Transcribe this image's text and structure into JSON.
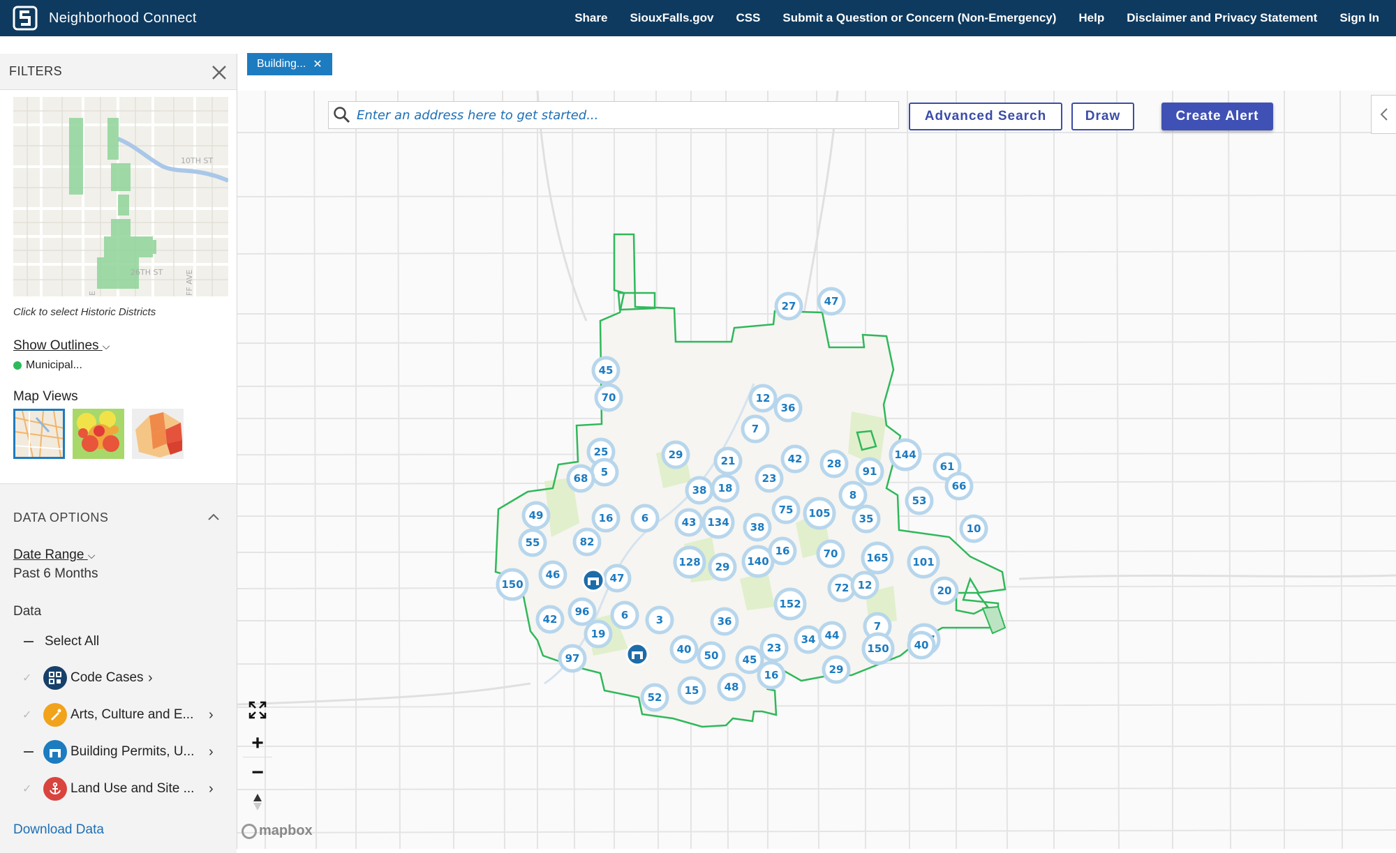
{
  "app": {
    "title": "Neighborhood Connect",
    "brand_color": "#0e3a5f",
    "accent_color": "#1d7bc0"
  },
  "topnav": [
    "Share",
    "SiouxFalls.gov",
    "CSS",
    "Submit a Question or Concern (Non-Emergency)",
    "Help",
    "Disclaimer and Privacy Statement",
    "Sign In"
  ],
  "active_filter_chip": "Building...",
  "filters_panel": {
    "header": "FILTERS",
    "historic_map": {
      "street_labels": [
        "10TH ST",
        "26TH ST",
        "E",
        "FF AVE"
      ],
      "caption": "Click to select Historic Districts"
    },
    "show_outlines_label": "Show Outlines",
    "outline_item": "Municipal...",
    "map_views_label": "Map Views",
    "map_views": [
      "street-map-view",
      "heat-map-view",
      "choropleth-map-view"
    ]
  },
  "data_options": {
    "title": "DATA OPTIONS",
    "date_range_label": "Date Range",
    "date_range_value": "Past 6 Months",
    "data_label": "Data",
    "select_all": "Select All",
    "categories": [
      {
        "label": "Code Cases",
        "icon": "code-cases-icon",
        "color": "#16406a",
        "state": "unchecked"
      },
      {
        "label": "Arts, Culture and E...",
        "icon": "paintbrush-icon",
        "color": "#f1a31b",
        "state": "unchecked"
      },
      {
        "label": "Building Permits, U...",
        "icon": "building-permit-icon",
        "color": "#1d7bc0",
        "state": "partial"
      },
      {
        "label": "Land Use and Site ...",
        "icon": "anchor-icon",
        "color": "#d9443f",
        "state": "unchecked"
      }
    ],
    "download_label": "Download Data"
  },
  "map": {
    "search_placeholder": "Enter an address here to get started...",
    "advanced_search_label": "Advanced Search",
    "draw_label": "Draw",
    "create_alert_label": "Create Alert",
    "attribution": "mapbox",
    "clusters": [
      "27",
      "47",
      "45",
      "70",
      "12",
      "36",
      "7",
      "25",
      "29",
      "21",
      "42",
      "28",
      "91",
      "144",
      "61",
      "66",
      "5",
      "68",
      "23",
      "38",
      "18",
      "8",
      "53",
      "49",
      "16",
      "6",
      "43",
      "134",
      "38",
      "75",
      "105",
      "35",
      "10",
      "55",
      "82",
      "128",
      "29",
      "140",
      "16",
      "70",
      "165",
      "101",
      "150",
      "46",
      "47",
      "72",
      "12",
      "20",
      "152",
      "96",
      "6",
      "3",
      "36",
      "7",
      "107",
      "42",
      "19",
      "40",
      "50",
      "23",
      "34",
      "44",
      "150",
      "40",
      "97",
      "45",
      "16",
      "29",
      "52",
      "15",
      "48"
    ],
    "pins": [
      "building-permit-pin",
      "building-permit-pin"
    ]
  }
}
